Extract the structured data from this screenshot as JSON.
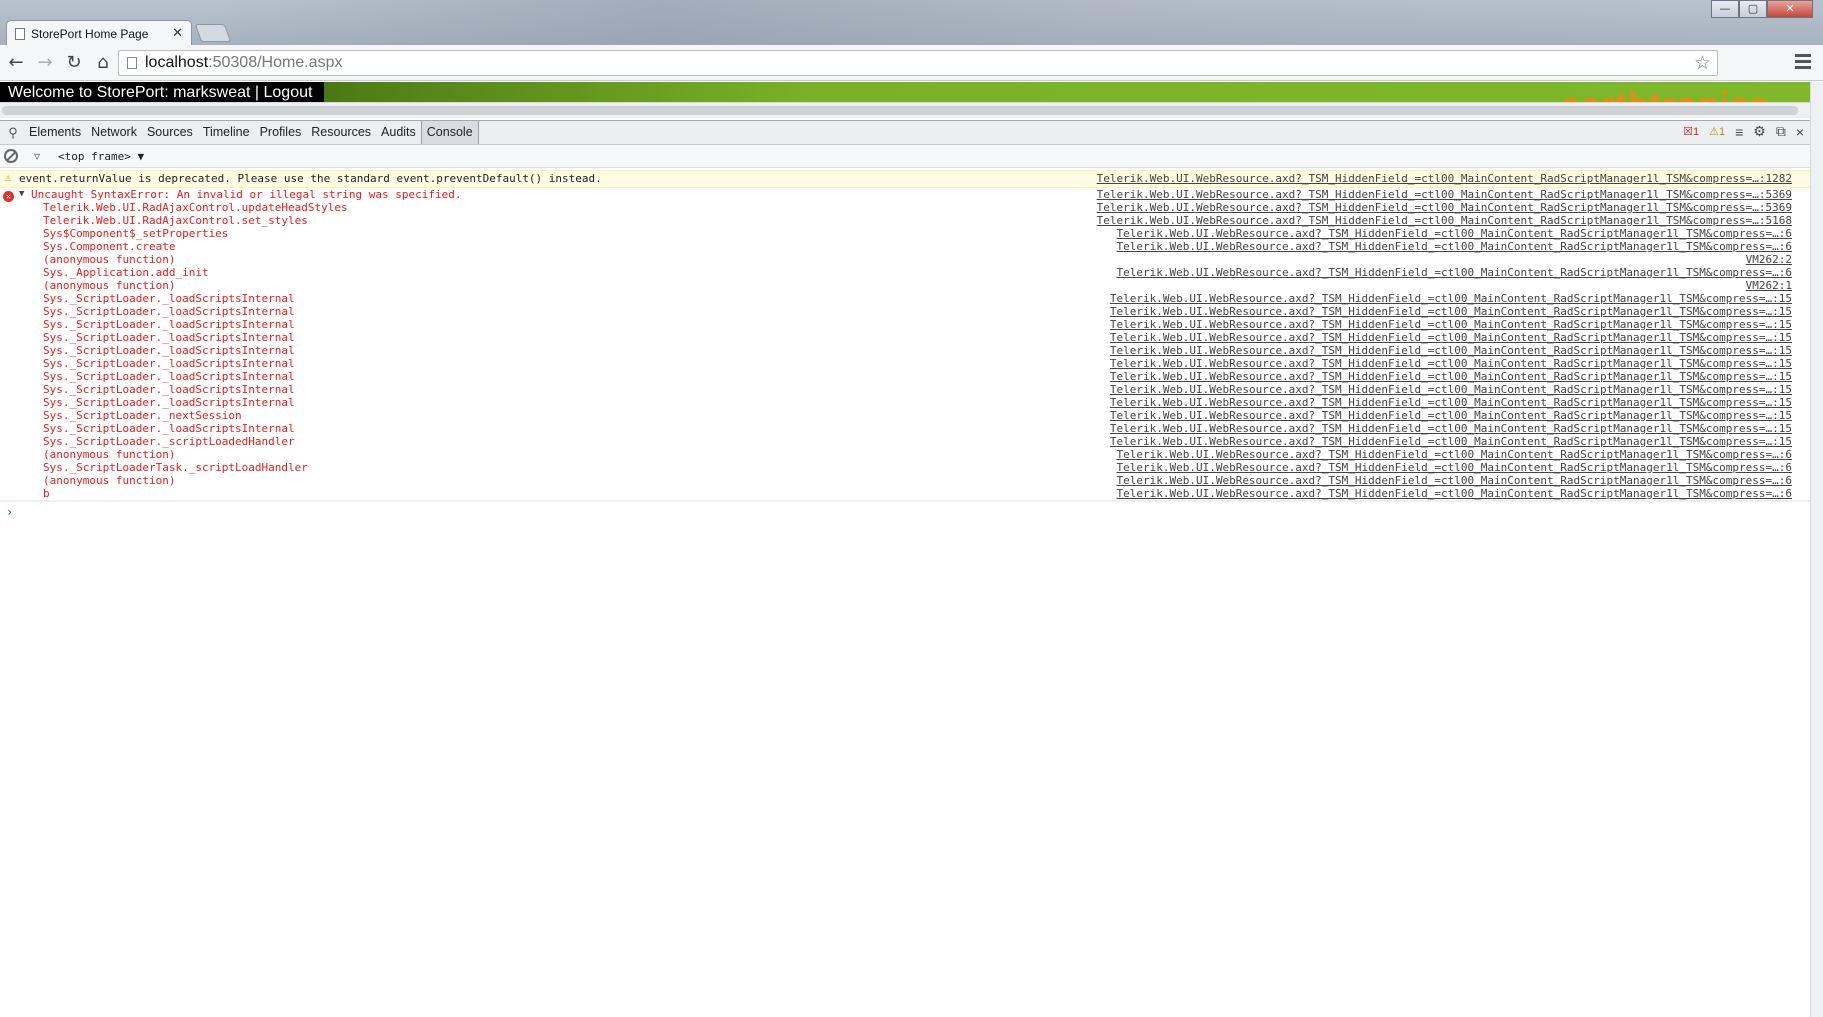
{
  "browser": {
    "tab_title": "StorePort Home Page",
    "tab_close": "✕",
    "url_host": "localhost",
    "url_rest": ":50308/Home.aspx",
    "window_controls": {
      "minimize": "—",
      "maximize": "▢",
      "close": "✕"
    }
  },
  "page": {
    "welcome_text": "Welcome to StorePort: marksweat | Logout",
    "brand_text": "earthtronics"
  },
  "devtools": {
    "tabs": [
      "Elements",
      "Network",
      "Sources",
      "Timeline",
      "Profiles",
      "Resources",
      "Audits",
      "Console"
    ],
    "selected_tab": "Console",
    "error_count": "1",
    "warning_count": "1",
    "frame_select": "<top frame> ▼"
  },
  "console": {
    "warning": {
      "text": "event.returnValue is deprecated. Please use the standard event.preventDefault() instead.",
      "source": "Telerik.Web.UI.WebResource.axd?_TSM_HiddenField_=ctl00_MainContent_RadScriptManager1l_TSM&compress=…:1282"
    },
    "error": {
      "text": "Uncaught SyntaxError: An invalid or illegal string was specified.",
      "source": "Telerik.Web.UI.WebResource.axd?_TSM_HiddenField_=ctl00_MainContent_RadScriptManager1l_TSM&compress=…:5369",
      "stack": [
        {
          "fn": "Telerik.Web.UI.RadAjaxControl.updateHeadStyles",
          "src": "Telerik.Web.UI.WebResource.axd?_TSM_HiddenField_=ctl00_MainContent_RadScriptManager1l_TSM&compress=…:5369"
        },
        {
          "fn": "Telerik.Web.UI.RadAjaxControl.set_styles",
          "src": "Telerik.Web.UI.WebResource.axd?_TSM_HiddenField_=ctl00_MainContent_RadScriptManager1l_TSM&compress=…:5168"
        },
        {
          "fn": "Sys$Component$_setProperties",
          "src": "Telerik.Web.UI.WebResource.axd?_TSM_HiddenField_=ctl00_MainContent_RadScriptManager1l_TSM&compress=…:6"
        },
        {
          "fn": "Sys.Component.create",
          "src": "Telerik.Web.UI.WebResource.axd?_TSM_HiddenField_=ctl00_MainContent_RadScriptManager1l_TSM&compress=…:6"
        },
        {
          "fn": "(anonymous function)",
          "src": "VM262:2"
        },
        {
          "fn": "Sys._Application.add_init",
          "src": "Telerik.Web.UI.WebResource.axd?_TSM_HiddenField_=ctl00_MainContent_RadScriptManager1l_TSM&compress=…:6"
        },
        {
          "fn": "(anonymous function)",
          "src": "VM262:1"
        },
        {
          "fn": "Sys._ScriptLoader._loadScriptsInternal",
          "src": "Telerik.Web.UI.WebResource.axd?_TSM_HiddenField_=ctl00_MainContent_RadScriptManager1l_TSM&compress=…:15"
        },
        {
          "fn": "Sys._ScriptLoader._loadScriptsInternal",
          "src": "Telerik.Web.UI.WebResource.axd?_TSM_HiddenField_=ctl00_MainContent_RadScriptManager1l_TSM&compress=…:15"
        },
        {
          "fn": "Sys._ScriptLoader._loadScriptsInternal",
          "src": "Telerik.Web.UI.WebResource.axd?_TSM_HiddenField_=ctl00_MainContent_RadScriptManager1l_TSM&compress=…:15"
        },
        {
          "fn": "Sys._ScriptLoader._loadScriptsInternal",
          "src": "Telerik.Web.UI.WebResource.axd?_TSM_HiddenField_=ctl00_MainContent_RadScriptManager1l_TSM&compress=…:15"
        },
        {
          "fn": "Sys._ScriptLoader._loadScriptsInternal",
          "src": "Telerik.Web.UI.WebResource.axd?_TSM_HiddenField_=ctl00_MainContent_RadScriptManager1l_TSM&compress=…:15"
        },
        {
          "fn": "Sys._ScriptLoader._loadScriptsInternal",
          "src": "Telerik.Web.UI.WebResource.axd?_TSM_HiddenField_=ctl00_MainContent_RadScriptManager1l_TSM&compress=…:15"
        },
        {
          "fn": "Sys._ScriptLoader._loadScriptsInternal",
          "src": "Telerik.Web.UI.WebResource.axd?_TSM_HiddenField_=ctl00_MainContent_RadScriptManager1l_TSM&compress=…:15"
        },
        {
          "fn": "Sys._ScriptLoader._loadScriptsInternal",
          "src": "Telerik.Web.UI.WebResource.axd?_TSM_HiddenField_=ctl00_MainContent_RadScriptManager1l_TSM&compress=…:15"
        },
        {
          "fn": "Sys._ScriptLoader._loadScriptsInternal",
          "src": "Telerik.Web.UI.WebResource.axd?_TSM_HiddenField_=ctl00_MainContent_RadScriptManager1l_TSM&compress=…:15"
        },
        {
          "fn": "Sys._ScriptLoader._nextSession",
          "src": "Telerik.Web.UI.WebResource.axd?_TSM_HiddenField_=ctl00_MainContent_RadScriptManager1l_TSM&compress=…:15"
        },
        {
          "fn": "Sys._ScriptLoader._loadScriptsInternal",
          "src": "Telerik.Web.UI.WebResource.axd?_TSM_HiddenField_=ctl00_MainContent_RadScriptManager1l_TSM&compress=…:15"
        },
        {
          "fn": "Sys._ScriptLoader._scriptLoadedHandler",
          "src": "Telerik.Web.UI.WebResource.axd?_TSM_HiddenField_=ctl00_MainContent_RadScriptManager1l_TSM&compress=…:15"
        },
        {
          "fn": "(anonymous function)",
          "src": "Telerik.Web.UI.WebResource.axd?_TSM_HiddenField_=ctl00_MainContent_RadScriptManager1l_TSM&compress=…:6"
        },
        {
          "fn": "Sys._ScriptLoaderTask._scriptLoadHandler",
          "src": "Telerik.Web.UI.WebResource.axd?_TSM_HiddenField_=ctl00_MainContent_RadScriptManager1l_TSM&compress=…:6"
        },
        {
          "fn": "(anonymous function)",
          "src": "Telerik.Web.UI.WebResource.axd?_TSM_HiddenField_=ctl00_MainContent_RadScriptManager1l_TSM&compress=…:6"
        },
        {
          "fn": "b",
          "src": "Telerik.Web.UI.WebResource.axd?_TSM_HiddenField_=ctl00_MainContent_RadScriptManager1l_TSM&compress=…:6"
        }
      ]
    },
    "prompt": "›"
  },
  "colors": {
    "error_red": "#e41e1e",
    "warning_yellow": "#fffbe5",
    "page_green": "#7fb82a",
    "brand_orange": "#e58a1a"
  },
  "icons": {
    "back": "arrow-left-icon",
    "forward": "arrow-right-icon",
    "reload": "reload-icon",
    "home": "home-icon",
    "star": "star-icon",
    "menu": "hamburger-menu-icon",
    "devtools_search": "search-icon",
    "clear": "clear-console-icon",
    "filter": "filter-icon",
    "settings": "gear-icon",
    "dock": "dock-icon",
    "close": "close-icon"
  }
}
